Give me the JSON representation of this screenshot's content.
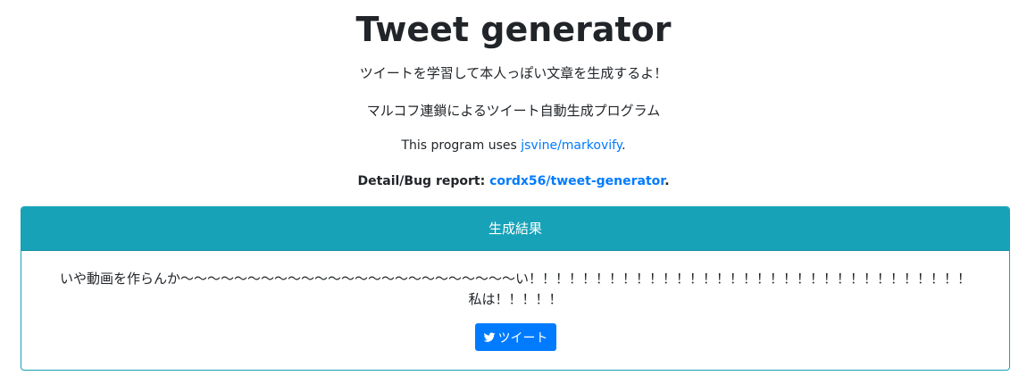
{
  "page": {
    "title": "Tweet generator",
    "subtitle1": "ツイートを学習して本人っぽい文章を生成するよ！",
    "subtitle2": "マルコフ連鎖によるツイート自動生成プログラム",
    "program_uses_prefix": "This program uses ",
    "program_uses_link": "jsvine/markovify",
    "program_uses_suffix": ".",
    "detail_prefix": "Detail/Bug report: ",
    "detail_link": "cordx56/tweet-generator",
    "detail_suffix": "."
  },
  "result_card": {
    "header": "生成結果",
    "text": "いや動画を作らんか〜〜〜〜〜〜〜〜〜〜〜〜〜〜〜〜〜〜〜〜〜〜〜〜〜い！！！！！！！！！！！！！！！！！！！！！！！！！！！！！！！！！私は！！！！！",
    "tweet_button_label": "ツイート",
    "tweet_icon": "twitter-bird-icon"
  },
  "colors": {
    "card_header_bg": "#17a2b8",
    "link": "#007bff",
    "button_bg": "#007bff"
  }
}
